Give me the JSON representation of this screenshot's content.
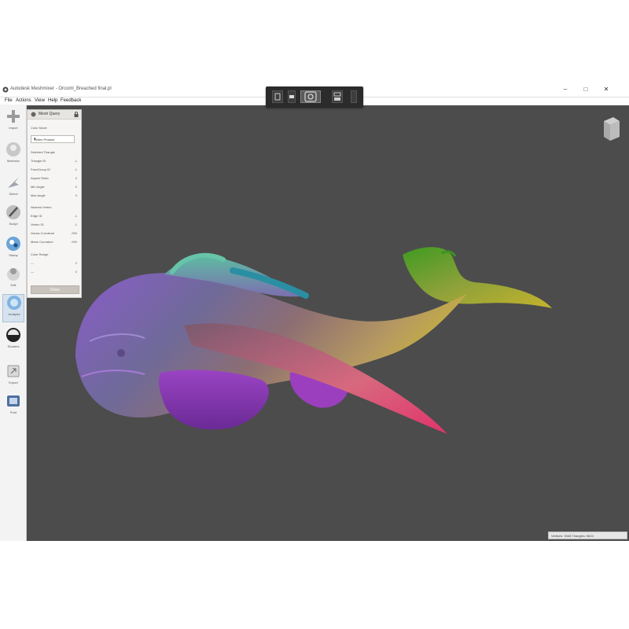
{
  "window": {
    "title": "Autodesk Meshmixer - Orcoml_Breached final.pl",
    "controls": {
      "minimize": "–",
      "maximize": "□",
      "close": "✕"
    }
  },
  "menubar": {
    "items": [
      "File",
      "Actions",
      "View",
      "Help",
      "Feedback"
    ]
  },
  "toolbar": {
    "tools": [
      {
        "label": "Import",
        "icon": "plus-icon"
      },
      {
        "label": "Meshmix",
        "icon": "meshmix-icon"
      },
      {
        "label": "Select",
        "icon": "select-arrow-icon"
      },
      {
        "label": "Sculpt",
        "icon": "sculpt-brush-icon"
      },
      {
        "label": "Stamp",
        "icon": "stamp-icon"
      },
      {
        "label": "Edit",
        "icon": "edit-icon"
      },
      {
        "label": "Analysis",
        "icon": "analysis-icon",
        "active": true
      },
      {
        "label": "Shaders",
        "icon": "shaders-icon"
      },
      {
        "label": "Export",
        "icon": "export-icon"
      },
      {
        "label": "Print",
        "icon": "print-icon"
      }
    ]
  },
  "panel": {
    "title": "Mesh Query",
    "color_mode_label": "Color Mode",
    "color_mode_value": "Vertex Product",
    "selected_triangle_heading": "Selected Triangle",
    "triangle_rows": [
      {
        "label": "Triangle ID",
        "value": "-1"
      },
      {
        "label": "FaceGroup ID",
        "value": "-1"
      },
      {
        "label": "Aspect Ratio",
        "value": "0"
      },
      {
        "label": "Min Angle",
        "value": "0"
      },
      {
        "label": "Max Angle",
        "value": "0"
      }
    ],
    "nearest_vertex_heading": "Nearest Vertex",
    "vertex_rows": [
      {
        "label": "Edge ID",
        "value": "-1"
      },
      {
        "label": "Vertex ID",
        "value": "-1"
      },
      {
        "label": "Gauss Curvature",
        "value": "-999"
      },
      {
        "label": "Mean Curvature",
        "value": "-999"
      }
    ],
    "color_range_heading": "Color Range",
    "range_rows": [
      {
        "label": "—",
        "value": "0"
      },
      {
        "label": "—",
        "value": "0"
      }
    ],
    "done_label": "Done"
  },
  "status": {
    "text": "Vertices: 3348  Triangles: 5824"
  },
  "colors": {
    "viewport_bg": "#4c4c4c",
    "accent_active": "#d6e3ef",
    "model_purple": "#8a3fb0",
    "model_teal": "#3aa6a0",
    "model_green": "#6fae2a",
    "model_pink": "#e06a86"
  }
}
